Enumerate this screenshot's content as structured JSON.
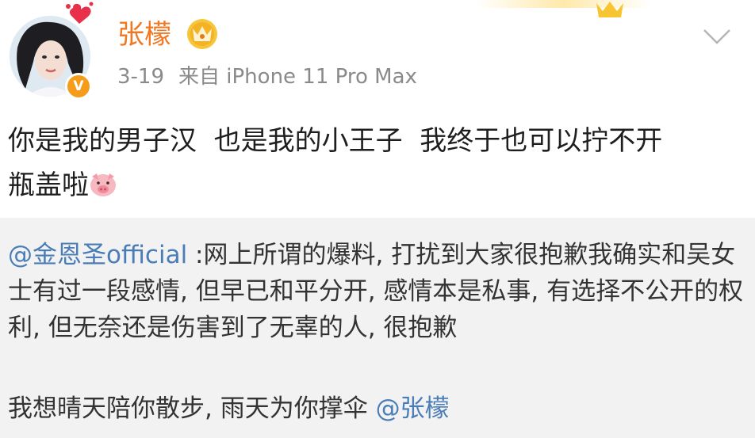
{
  "post": {
    "username": "张檬",
    "date": "3-19",
    "source": "来自 iPhone 11 Pro Max",
    "body_line1": "你是我的男子汉  也是我的小王子  我终于也可以拧不开",
    "body_line2": "瓶盖啦",
    "emoji": "pig-face-icon",
    "verified_badge": "V"
  },
  "quote": {
    "mention": "@金恩圣official",
    "text": " :网上所谓的爆料, 打扰到大家很抱歉我确实和吴女士有过一段感情, 但早已和平分开, 感情本是私事, 有选择不公开的权利, 但无奈还是伤害到了无辜的人, 很抱歉",
    "line2_text": "我想晴天陪你散步,  雨天为你撑伞 ",
    "line2_mention": "@张檬"
  },
  "colors": {
    "username": "#f0761f",
    "mention": "#4a7db8",
    "meta": "#8a8a8a",
    "body": "#1e1e1e",
    "quote_bg": "#f2f2f2",
    "badge": "#f59c1a"
  }
}
